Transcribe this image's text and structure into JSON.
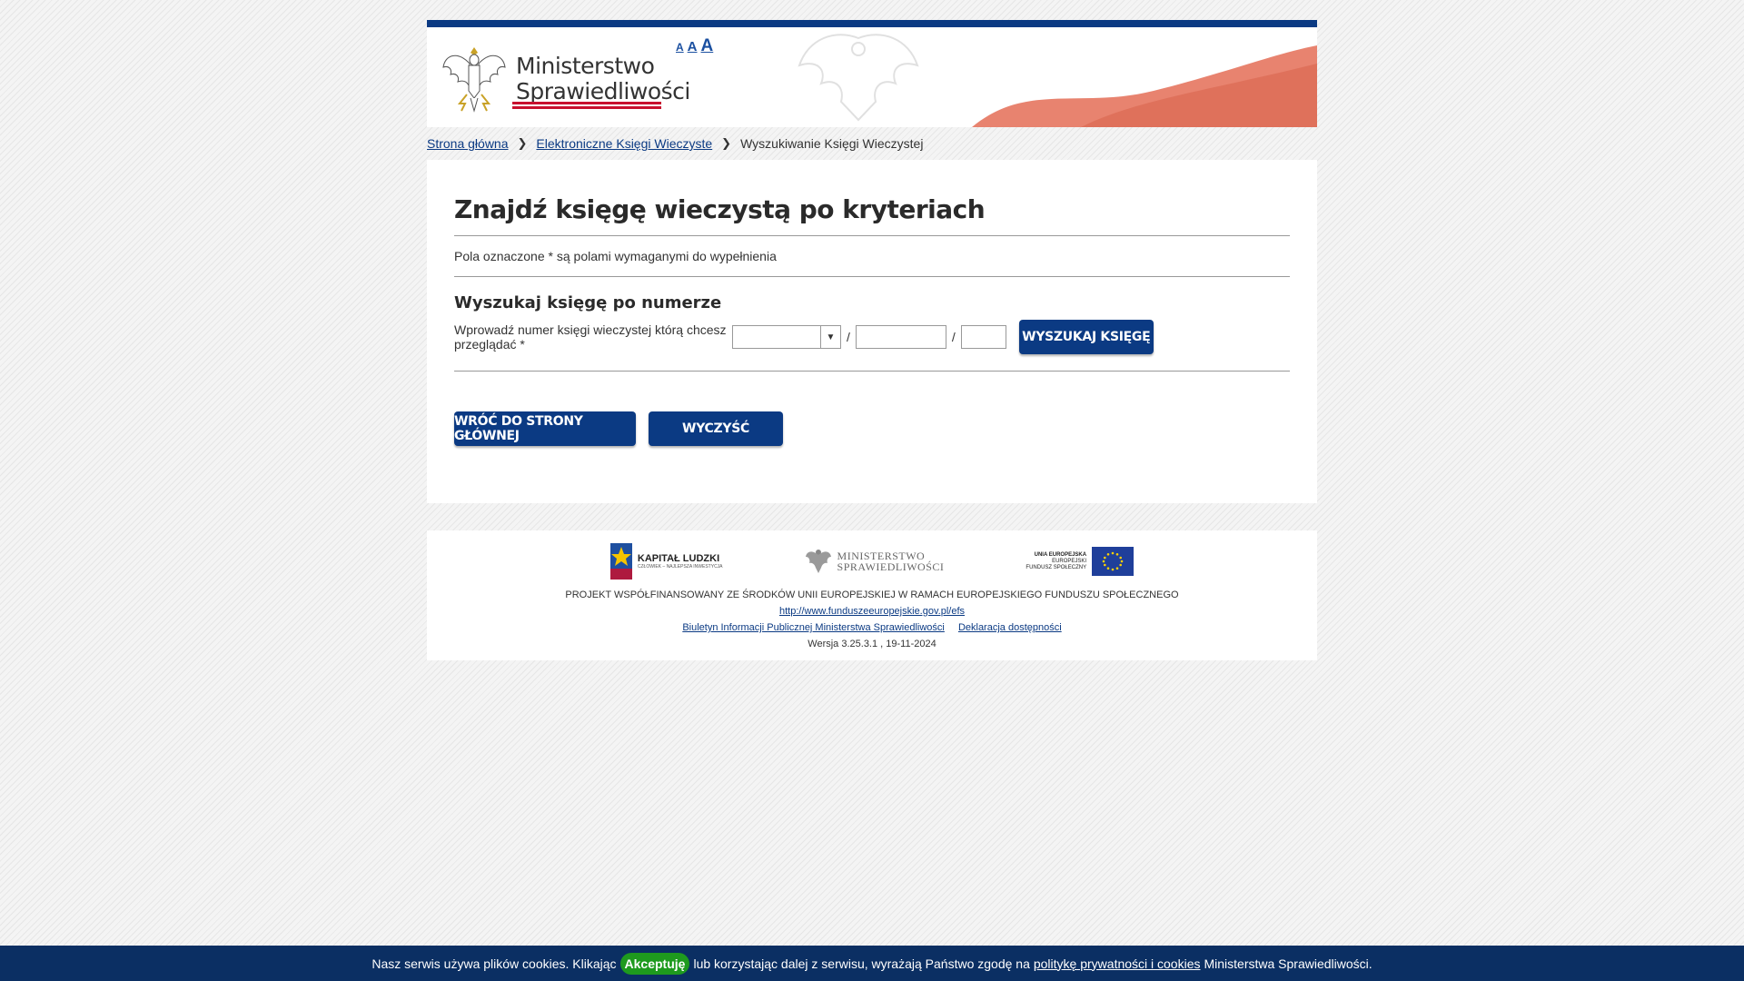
{
  "header": {
    "logo_line1": "Ministerstwo",
    "logo_line2": "Sprawiedliwości",
    "font_small": "A",
    "font_medium": "A",
    "font_large": "A"
  },
  "breadcrumb": {
    "home": "Strona główna",
    "ekw": "Elektroniczne Księgi Wieczyste",
    "current": "Wyszukiwanie Księgi Wieczystej",
    "separator": "❯"
  },
  "main": {
    "title": "Znajdź księgę wieczystą po kryteriach",
    "required_note": "Pola oznaczone * są polami wymaganymi do wypełnienia",
    "section_title": "Wyszukaj księgę po numerze",
    "search_label": "Wprowadź numer księgi wieczystej którą chcesz przeglądać *",
    "court_code_value": "",
    "book_number_value": "",
    "check_digit_value": "",
    "slash": "/",
    "search_button": "WYSZUKAJ KSIĘGĘ",
    "back_button": "WRÓĆ DO STRONY GŁÓWNEJ",
    "clear_button": "WYCZYŚĆ"
  },
  "footer": {
    "kl_title": "KAPITAŁ LUDZKI",
    "kl_subtitle": "CZŁOWIEK – NAJLEPSZA INWESTYCJA",
    "ms_line1": "MINISTERSTWO",
    "ms_line2": "SPRAWIEDLIWOŚCI",
    "ue_line1": "UNIA EUROPEJSKA",
    "ue_line2": "EUROPEJSKI",
    "ue_line3": "FUNDUSZ SPOŁECZNY",
    "project": "PROJEKT WSPÓŁFINANSOWANY ZE ŚRODKÓW UNII EUROPEJSKIEJ W RAMACH EUROPEJSKIEGO FUNDUSZU SPOŁECZNEGO",
    "efs_link": "http://www.funduszeeuropejskie.gov.pl/efs",
    "bip_link": "Biuletyn Informacji Publicznej Ministerstwa Sprawiedliwości",
    "accessibility_link": "Deklaracja dostępności",
    "version": "Wersja 3.25.3.1 , 19-11-2024"
  },
  "cookie": {
    "text_before": "Nasz serwis używa plików cookies. Klikając",
    "accept": "Akceptuję",
    "text_middle": "lub korzystając dalej z serwisu, wyrażają Państwo zgodę na",
    "policy_link": "politykę prywatności i cookies",
    "text_after": "Ministerstwa Sprawiedliwości."
  },
  "colors": {
    "primary": "#0b3a83",
    "cookie_bar": "#0b2f63",
    "accept_green": "#1e9a1e",
    "flag_red": "#e8836f"
  },
  "icons": {
    "breadcrumb_separator": "chevron-right-icon",
    "select_arrow": "triangle-down-icon"
  }
}
